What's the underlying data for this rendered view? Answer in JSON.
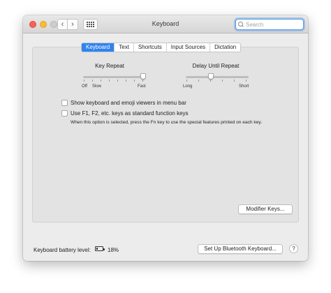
{
  "window": {
    "title": "Keyboard"
  },
  "toolbar": {
    "back_icon": "‹",
    "forward_icon": "›",
    "search_placeholder": "Search"
  },
  "tabs": [
    {
      "label": "Keyboard",
      "active": true
    },
    {
      "label": "Text",
      "active": false
    },
    {
      "label": "Shortcuts",
      "active": false
    },
    {
      "label": "Input Sources",
      "active": false
    },
    {
      "label": "Dictation",
      "active": false
    }
  ],
  "key_repeat": {
    "title": "Key Repeat",
    "label_off": "Off",
    "label_slow": "Slow",
    "label_fast": "Fast",
    "value": 0.95
  },
  "delay_until_repeat": {
    "title": "Delay Until Repeat",
    "label_long": "Long",
    "label_short": "Short",
    "value": 0.4
  },
  "options": {
    "show_viewers": {
      "label": "Show keyboard and emoji viewers in menu bar",
      "checked": false
    },
    "function_keys": {
      "label": "Use F1, F2, etc. keys as standard function keys",
      "checked": false
    },
    "function_keys_help": "When this option is selected, press the Fn key to use the special features printed on each key."
  },
  "buttons": {
    "modifier_keys": "Modifier Keys...",
    "bluetooth_keyboard": "Set Up Bluetooth Keyboard...",
    "help": "?"
  },
  "footer": {
    "battery_label": "Keyboard battery level:",
    "battery_percent": "18%"
  },
  "colors": {
    "accent": "#2f83f1",
    "close": "#fc5f57",
    "minimize": "#fdbc2e"
  }
}
